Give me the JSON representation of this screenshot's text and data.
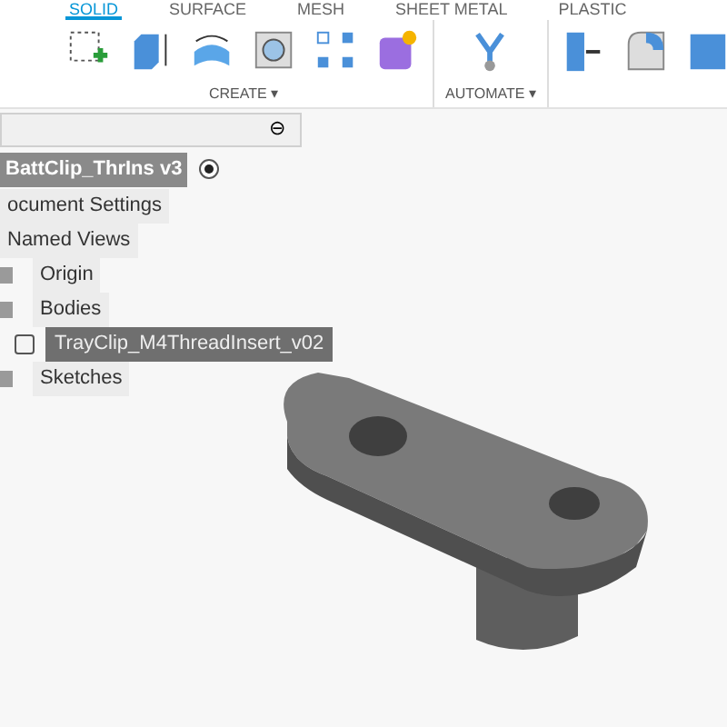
{
  "toolbar": {
    "tabs": [
      {
        "label": "SOLID",
        "selected": true
      },
      {
        "label": "SURFACE",
        "selected": false
      },
      {
        "label": "MESH",
        "selected": false
      },
      {
        "label": "SHEET METAL",
        "selected": false
      },
      {
        "label": "PLASTIC",
        "selected": false
      }
    ],
    "groups": [
      {
        "label": "CREATE ▾"
      },
      {
        "label": "AUTOMATE ▾"
      }
    ]
  },
  "browser": {
    "collapse_icon": "⊖",
    "root": {
      "label": "BattClip_ThrIns v3",
      "selected": true,
      "children": [
        {
          "label": "ocument Settings",
          "kind": "setting",
          "selected": false
        },
        {
          "label": "Named Views",
          "kind": "setting",
          "selected": false
        },
        {
          "label": "Origin",
          "kind": "folder",
          "selected": false
        },
        {
          "label": "Bodies",
          "kind": "folder",
          "selected": false,
          "children": [
            {
              "label": "TrayClip_M4ThreadInsert_v02",
              "kind": "body",
              "selected": true,
              "checked": false
            }
          ]
        },
        {
          "label": "Sketches",
          "kind": "folder",
          "selected": false
        }
      ]
    }
  }
}
